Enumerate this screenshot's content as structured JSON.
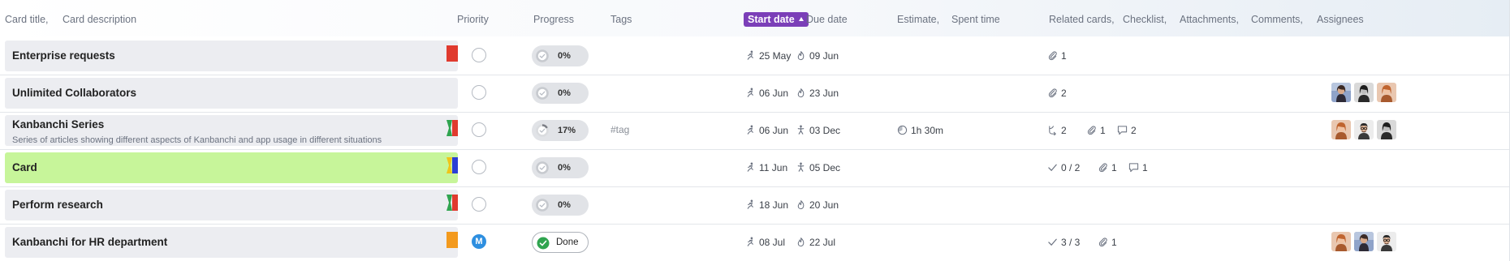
{
  "header": {
    "card_title": "Card title,",
    "card_description": "Card description",
    "priority": "Priority",
    "progress": "Progress",
    "tags": "Tags",
    "start_date": "Start date",
    "due_date": "Due date",
    "estimate": "Estimate,",
    "spent_time": "Spent time",
    "related_cards": "Related cards,",
    "checklist": "Checklist,",
    "attachments": "Attachments,",
    "comments": "Comments,",
    "assignees": "Assignees"
  },
  "rows": [
    {
      "title": "Enterprise requests",
      "description": "",
      "flag": [
        "#e03a2e"
      ],
      "priority": "",
      "progress": "0%",
      "progress_fraction": 0,
      "tag": "",
      "start": "25 May",
      "due": "09 Jun",
      "due_icon": "flame-icon",
      "spent": "",
      "related": "",
      "checklist": "",
      "attachments": "1",
      "comments": "",
      "assignees": []
    },
    {
      "title": "Unlimited Collaborators",
      "description": "",
      "flag": [],
      "priority": "",
      "progress": "0%",
      "progress_fraction": 0,
      "tag": "",
      "start": "06 Jun",
      "due": "23 Jun",
      "due_icon": "flame-icon",
      "spent": "",
      "related": "",
      "checklist": "",
      "attachments": "2",
      "comments": "",
      "assignees": [
        "avatar-dark-hair-woman",
        "avatar-woman-bw",
        "avatar-red-hair-woman"
      ]
    },
    {
      "title": "Kanbanchi Series",
      "description": "Series of articles showing different aspects of Kanbanchi and app usage in different situations",
      "flag": [
        "#2fa44f",
        "#e03a2e"
      ],
      "priority": "",
      "progress": "17%",
      "progress_fraction": 0.17,
      "tag": "#tag",
      "start": "06 Jun",
      "due": "03 Dec",
      "due_icon": "finish-runner-icon",
      "spent": "1h 30m",
      "related": "2",
      "checklist": "",
      "attachments": "1",
      "comments": "2",
      "assignees": [
        "avatar-red-hair-woman",
        "avatar-man-glasses",
        "avatar-woman-bw"
      ]
    },
    {
      "title": "Card",
      "description": "",
      "flag": [
        "#f0c419",
        "#2b3fd6"
      ],
      "priority": "",
      "progress": "0%",
      "progress_fraction": 0,
      "tag": "",
      "start": "11 Jun",
      "due": "05 Dec",
      "due_icon": "finish-runner-icon",
      "spent": "",
      "related": "",
      "checklist": "0 / 2",
      "attachments": "1",
      "comments": "1",
      "assignees": []
    },
    {
      "title": "Perform research",
      "description": "",
      "flag": [
        "#2fa44f",
        "#e03a2e"
      ],
      "priority": "",
      "progress": "0%",
      "progress_fraction": 0,
      "tag": "",
      "start": "18 Jun",
      "due": "20 Jun",
      "due_icon": "flame-icon",
      "spent": "",
      "related": "",
      "checklist": "",
      "attachments": "",
      "comments": "",
      "assignees": []
    },
    {
      "title": "Kanbanchi for HR department",
      "description": "",
      "flag": [
        "#f39a1e"
      ],
      "priority": "M",
      "progress": "Done",
      "progress_fraction": 1,
      "tag": "",
      "start": "08 Jul",
      "due": "22 Jul",
      "due_icon": "flame-icon",
      "spent": "",
      "related": "",
      "checklist": "3 / 3",
      "attachments": "1",
      "comments": "",
      "assignees": [
        "avatar-red-hair-woman",
        "avatar-dark-hair-woman",
        "avatar-man-glasses"
      ]
    }
  ],
  "colors": {
    "sort_accent": "#7b3fb8",
    "highlight_row": "#c7f59a",
    "title_cell": "#ecedf1",
    "done_check": "#2fa44f",
    "priority_medium": "#2e8fe0"
  }
}
